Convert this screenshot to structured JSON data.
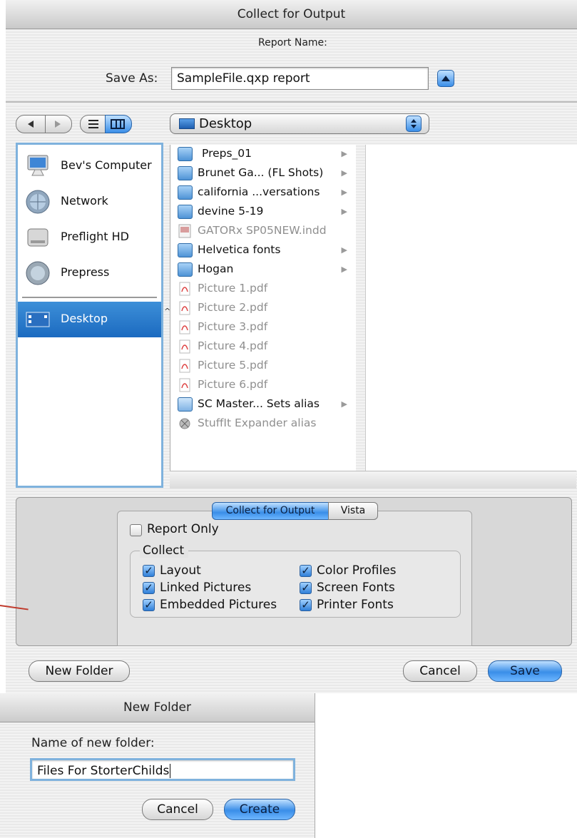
{
  "window": {
    "title": "Collect for Output"
  },
  "save": {
    "report_name_label": "Report Name:",
    "save_as_label": "Save As:",
    "save_as_value": "SampleFile.qxp report"
  },
  "browser": {
    "location": "Desktop",
    "sidebar": [
      {
        "label": "Bev's Computer",
        "icon": "computer-icon"
      },
      {
        "label": "Network",
        "icon": "network-globe-icon"
      },
      {
        "label": "Preflight HD",
        "icon": "hard-drive-icon"
      },
      {
        "label": "Prepress",
        "icon": "network-volume-icon"
      },
      {
        "label": "Desktop",
        "icon": "desktop-icon",
        "selected": true
      }
    ],
    "files": [
      {
        "name": "Preps_01",
        "kind": "folder",
        "dim": false,
        "arrow": true
      },
      {
        "name": "Brunet Ga... (FL Shots)",
        "kind": "folder",
        "dim": false,
        "arrow": true
      },
      {
        "name": "california ...versations",
        "kind": "folder",
        "dim": false,
        "arrow": true
      },
      {
        "name": "devine 5-19",
        "kind": "folder",
        "dim": false,
        "arrow": true
      },
      {
        "name": "GATORx SP05NEW.indd",
        "kind": "indd",
        "dim": true,
        "arrow": false
      },
      {
        "name": "Helvetica fonts",
        "kind": "folder",
        "dim": false,
        "arrow": true
      },
      {
        "name": "Hogan",
        "kind": "folder",
        "dim": false,
        "arrow": true
      },
      {
        "name": "Picture 1.pdf",
        "kind": "pdf",
        "dim": true,
        "arrow": false
      },
      {
        "name": "Picture 2.pdf",
        "kind": "pdf",
        "dim": true,
        "arrow": false
      },
      {
        "name": "Picture 3.pdf",
        "kind": "pdf",
        "dim": true,
        "arrow": false
      },
      {
        "name": "Picture 4.pdf",
        "kind": "pdf",
        "dim": true,
        "arrow": false
      },
      {
        "name": "Picture 5.pdf",
        "kind": "pdf",
        "dim": true,
        "arrow": false
      },
      {
        "name": "Picture 6.pdf",
        "kind": "pdf",
        "dim": true,
        "arrow": false
      },
      {
        "name": "SC Master... Sets alias",
        "kind": "alias-folder",
        "dim": false,
        "arrow": true
      },
      {
        "name": "StuffIt Expander alias",
        "kind": "app-alias",
        "dim": true,
        "arrow": false
      }
    ]
  },
  "options": {
    "tabs": [
      {
        "label": "Collect for Output",
        "active": true
      },
      {
        "label": "Vista",
        "active": false
      }
    ],
    "report_only": {
      "label": "Report Only",
      "checked": false
    },
    "collect_group_label": "Collect",
    "collect": [
      {
        "label": "Layout",
        "checked": true
      },
      {
        "label": "Linked Pictures",
        "checked": true
      },
      {
        "label": "Embedded Pictures",
        "checked": true
      },
      {
        "label": "Color Profiles",
        "checked": true
      },
      {
        "label": "Screen Fonts",
        "checked": true
      },
      {
        "label": "Printer Fonts",
        "checked": true
      }
    ]
  },
  "buttons": {
    "new_folder": "New Folder",
    "cancel": "Cancel",
    "save": "Save"
  },
  "new_folder_dialog": {
    "title": "New Folder",
    "prompt": "Name of new folder:",
    "value": "Files For StorterChilds",
    "cancel": "Cancel",
    "create": "Create"
  },
  "colors": {
    "accent": "#3a8ee8",
    "selection": "#1b6ac0",
    "focus_ring": "#7fb2dd"
  }
}
